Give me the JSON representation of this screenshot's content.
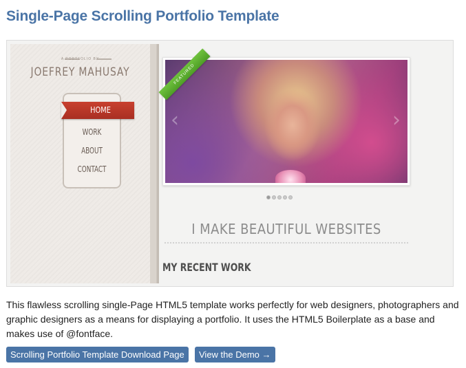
{
  "page": {
    "title": "Single-Page Scrolling Portfolio Template",
    "description": "This flawless scrolling single-Page HTML5 template works perfectly for web designers, photographers and graphic designers as a means for displaying a portfolio. It uses the HTML5 Boilerplate as a base and makes use of @fontface."
  },
  "preview": {
    "sidebar": {
      "tagline": "A PORTFOLIO BY",
      "site_name": "JOEFREY MAHUSAY",
      "nav": [
        "HOME",
        "WORK",
        "ABOUT",
        "CONTACT"
      ],
      "active_nav": "HOME"
    },
    "slider": {
      "badge": "FEATURED",
      "prev_arrow": "‹",
      "next_arrow": "›",
      "dot_count": 5,
      "active_dot": 1
    },
    "hero_text": "I MAKE BEAUTIFUL WEBSITES",
    "section_heading": "MY RECENT WORK"
  },
  "buttons": {
    "download": "Scrolling Portfolio Template Download Page",
    "demo": "View the Demo →"
  },
  "colors": {
    "link_blue": "#4a74a6",
    "ribbon_red": "#b83626",
    "featured_green": "#5cae30"
  }
}
